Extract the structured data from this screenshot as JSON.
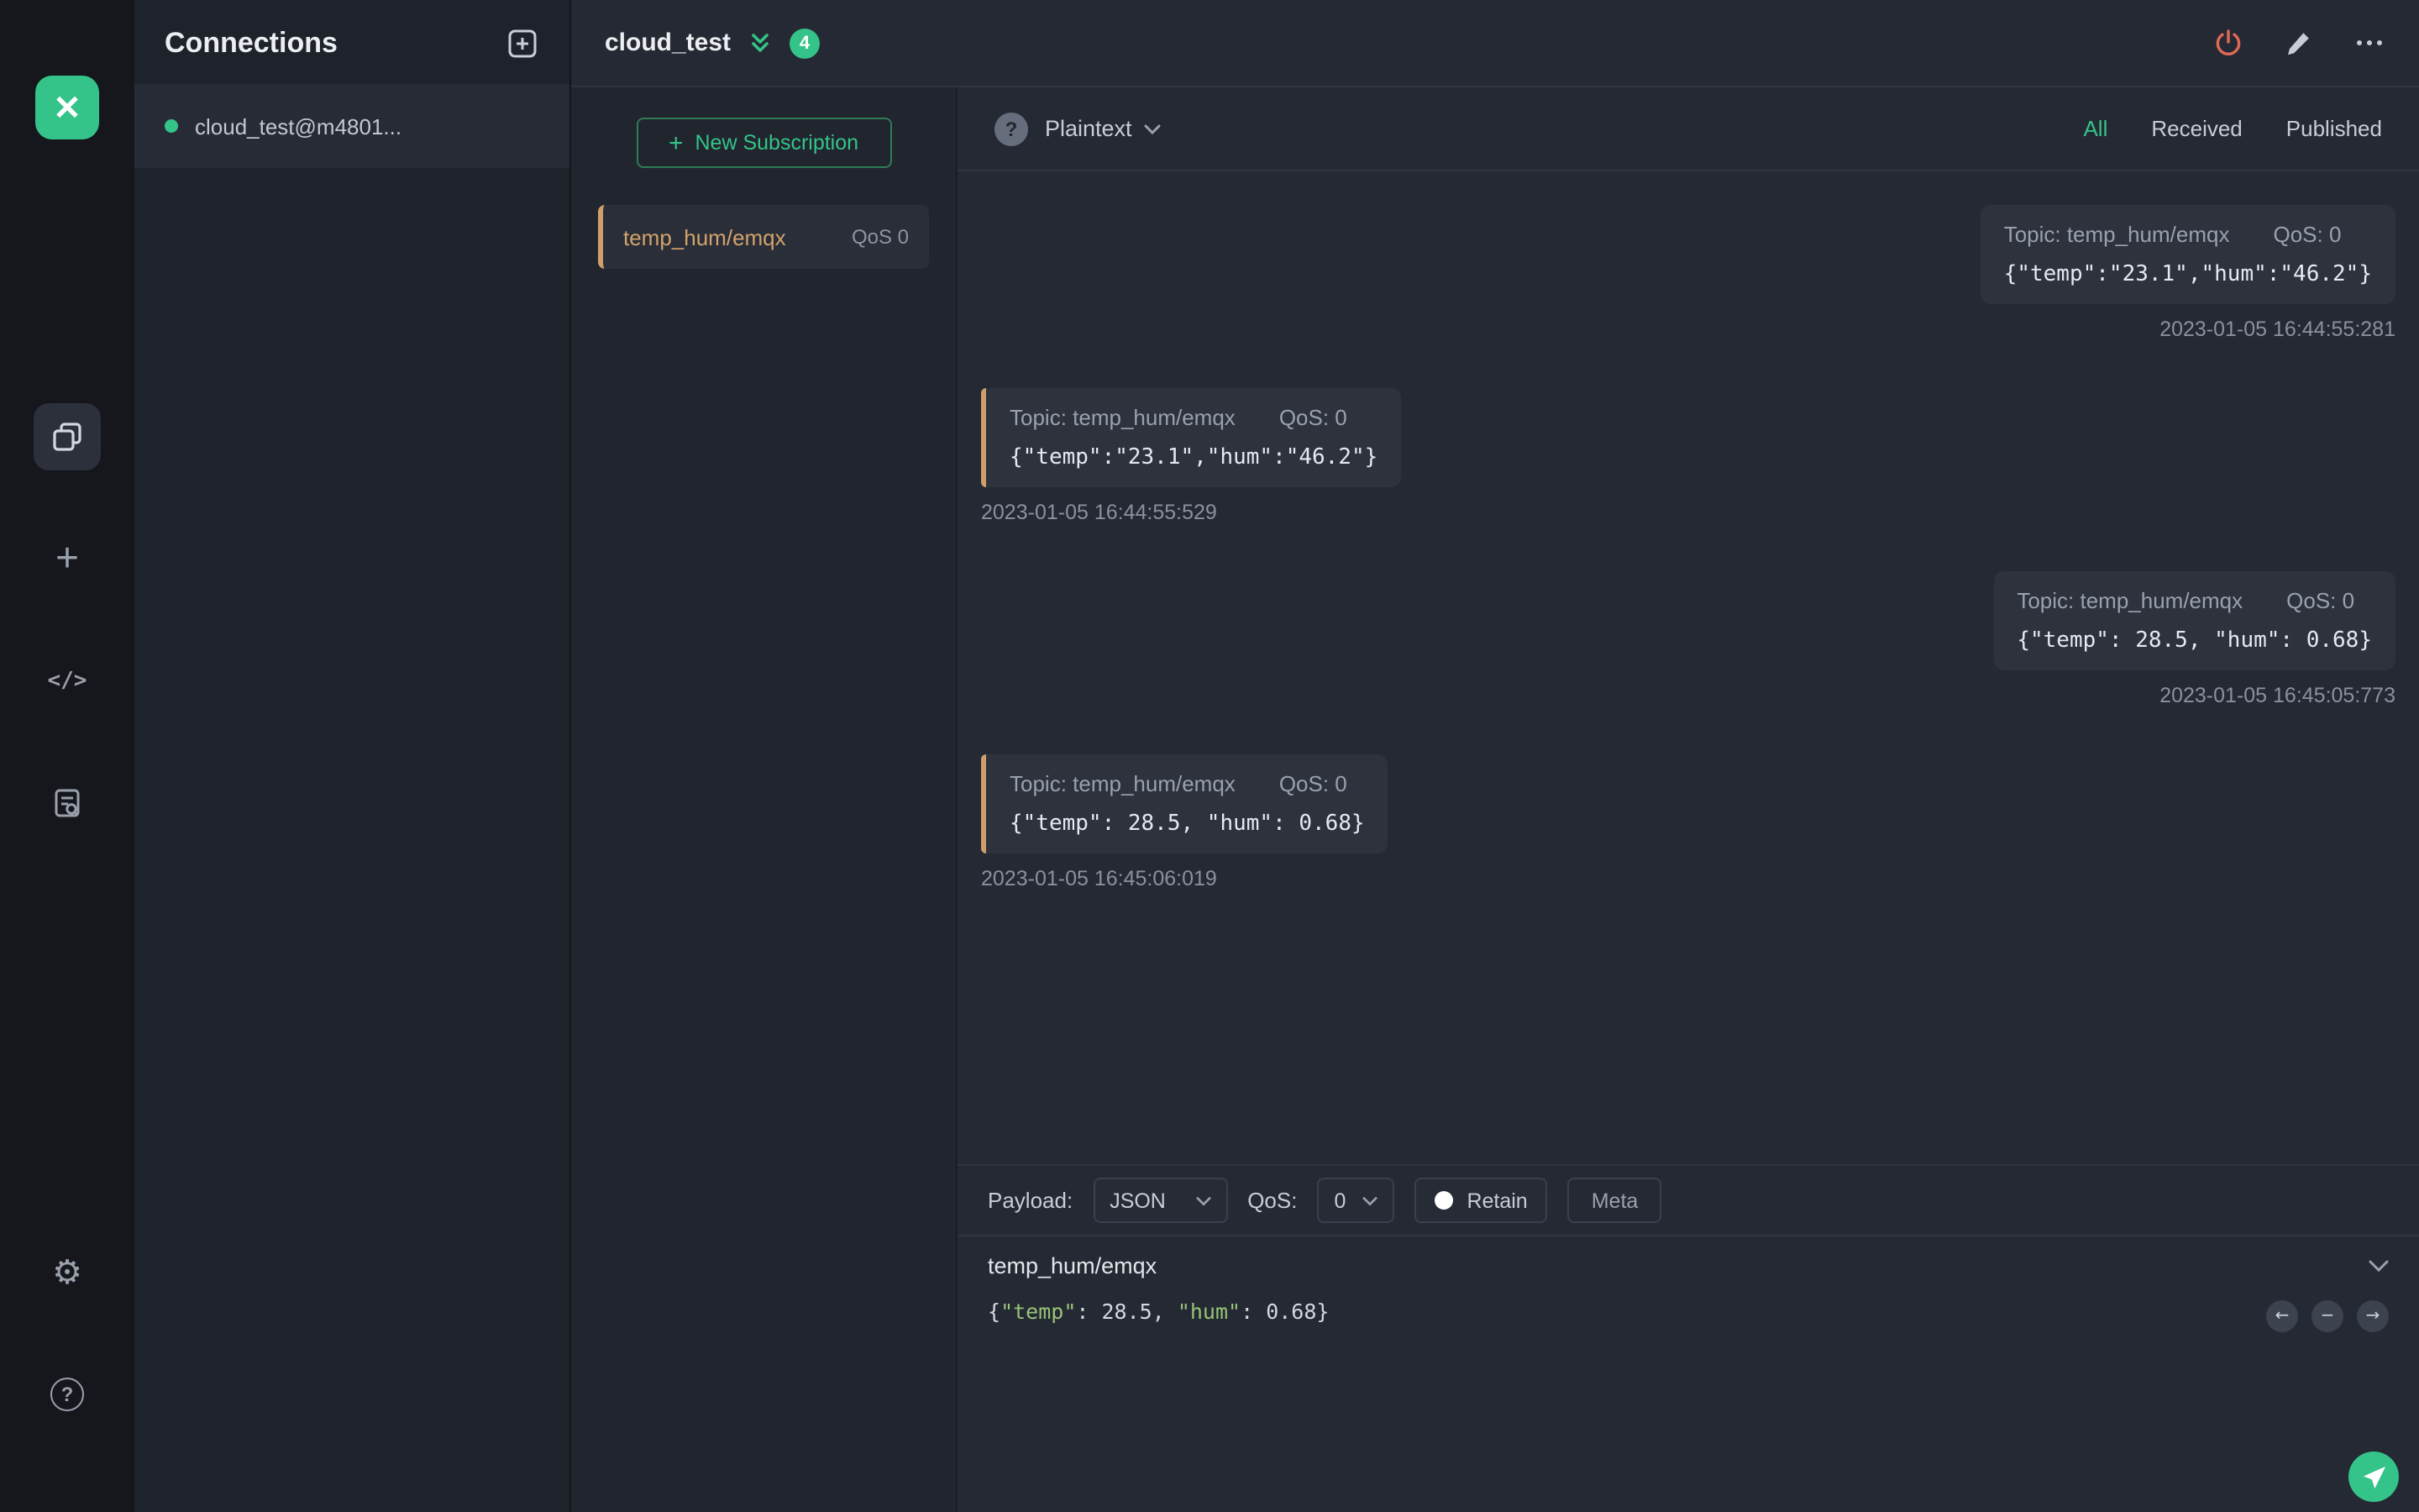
{
  "colors": {
    "accent_green": "#34c388",
    "accent_orange": "#cf9f6a",
    "danger_red": "#df6a55"
  },
  "rail": {
    "icons": [
      "mqttx-logo",
      "connections-icon",
      "new-connection-icon",
      "script-icon",
      "log-icon",
      "settings-gear-icon",
      "help-icon"
    ],
    "code_glyph": "</>"
  },
  "connections": {
    "title": "Connections",
    "items": [
      {
        "name": "cloud_test@m4801...",
        "status": "connected"
      }
    ]
  },
  "header": {
    "title": "cloud_test",
    "badge_count": "4"
  },
  "subscriptions": {
    "new_button_label": "New Subscription",
    "items": [
      {
        "topic": "temp_hum/emqx",
        "qos": "QoS 0"
      }
    ]
  },
  "messages": {
    "toolbar": {
      "format": "Plaintext",
      "filters": [
        "All",
        "Received",
        "Published"
      ],
      "active_filter": "All"
    },
    "items": [
      {
        "direction": "published",
        "topic": "Topic: temp_hum/emqx",
        "qos": "QoS: 0",
        "payload": "{\"temp\":\"23.1\",\"hum\":\"46.2\"}",
        "time": "2023-01-05 16:44:55:281"
      },
      {
        "direction": "received",
        "topic": "Topic: temp_hum/emqx",
        "qos": "QoS: 0",
        "payload": "{\"temp\":\"23.1\",\"hum\":\"46.2\"}",
        "time": "2023-01-05 16:44:55:529"
      },
      {
        "direction": "published",
        "topic": "Topic: temp_hum/emqx",
        "qos": "QoS: 0",
        "payload": "{\"temp\": 28.5, \"hum\": 0.68}",
        "time": "2023-01-05 16:45:05:773"
      },
      {
        "direction": "received",
        "topic": "Topic: temp_hum/emqx",
        "qos": "QoS: 0",
        "payload": "{\"temp\": 28.5, \"hum\": 0.68}",
        "time": "2023-01-05 16:45:06:019"
      }
    ]
  },
  "publish": {
    "payload_label": "Payload:",
    "payload_format": "JSON",
    "qos_label": "QoS:",
    "qos_value": "0",
    "retain_label": "Retain",
    "meta_label": "Meta",
    "topic_value": "temp_hum/emqx",
    "payload_value": "{\"temp\": 28.5, \"hum\": 0.68}",
    "tokens": [
      {
        "text": "{"
      },
      {
        "text": "\"temp\""
      },
      {
        "text": ": 28.5, "
      },
      {
        "text": "\"hum\""
      },
      {
        "text": ": 0.68}"
      }
    ]
  }
}
